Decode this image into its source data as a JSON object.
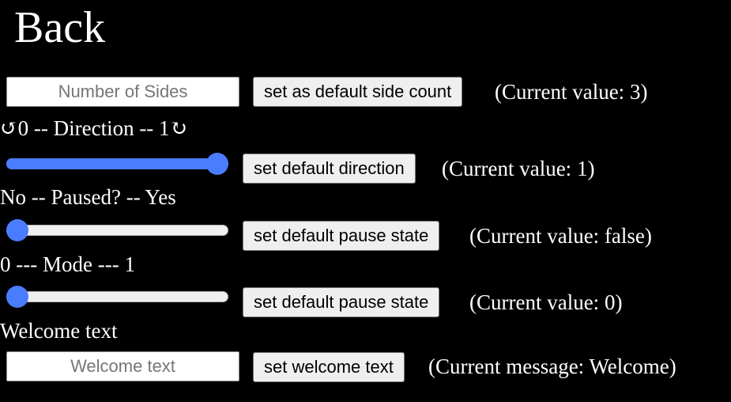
{
  "back": {
    "label": "Back"
  },
  "sides": {
    "placeholder": "Number of Sides",
    "button_label": "set as default side count",
    "current_text": "(Current value: 3)"
  },
  "direction": {
    "label": "↺0 -- Direction -- 1↻",
    "slider_value": 1,
    "slider_min": 0,
    "slider_max": 1,
    "button_label": "set default direction",
    "current_text": "(Current value: 1)"
  },
  "paused": {
    "label": "No -- Paused? -- Yes",
    "slider_value": 0,
    "slider_min": 0,
    "slider_max": 1,
    "button_label": "set default pause state",
    "current_text": "(Current value: false)"
  },
  "mode": {
    "label": "0 --- Mode --- 1",
    "slider_value": 0,
    "slider_min": 0,
    "slider_max": 1,
    "button_label": "set default pause state",
    "current_text": "(Current value: 0)"
  },
  "welcome": {
    "label": "Welcome text",
    "placeholder": "Welcome text",
    "button_label": "set welcome text",
    "current_text": "(Current message: Welcome)"
  },
  "colors": {
    "background": "#000000",
    "slider_accent": "#4a7cff",
    "text": "#ffffff"
  }
}
